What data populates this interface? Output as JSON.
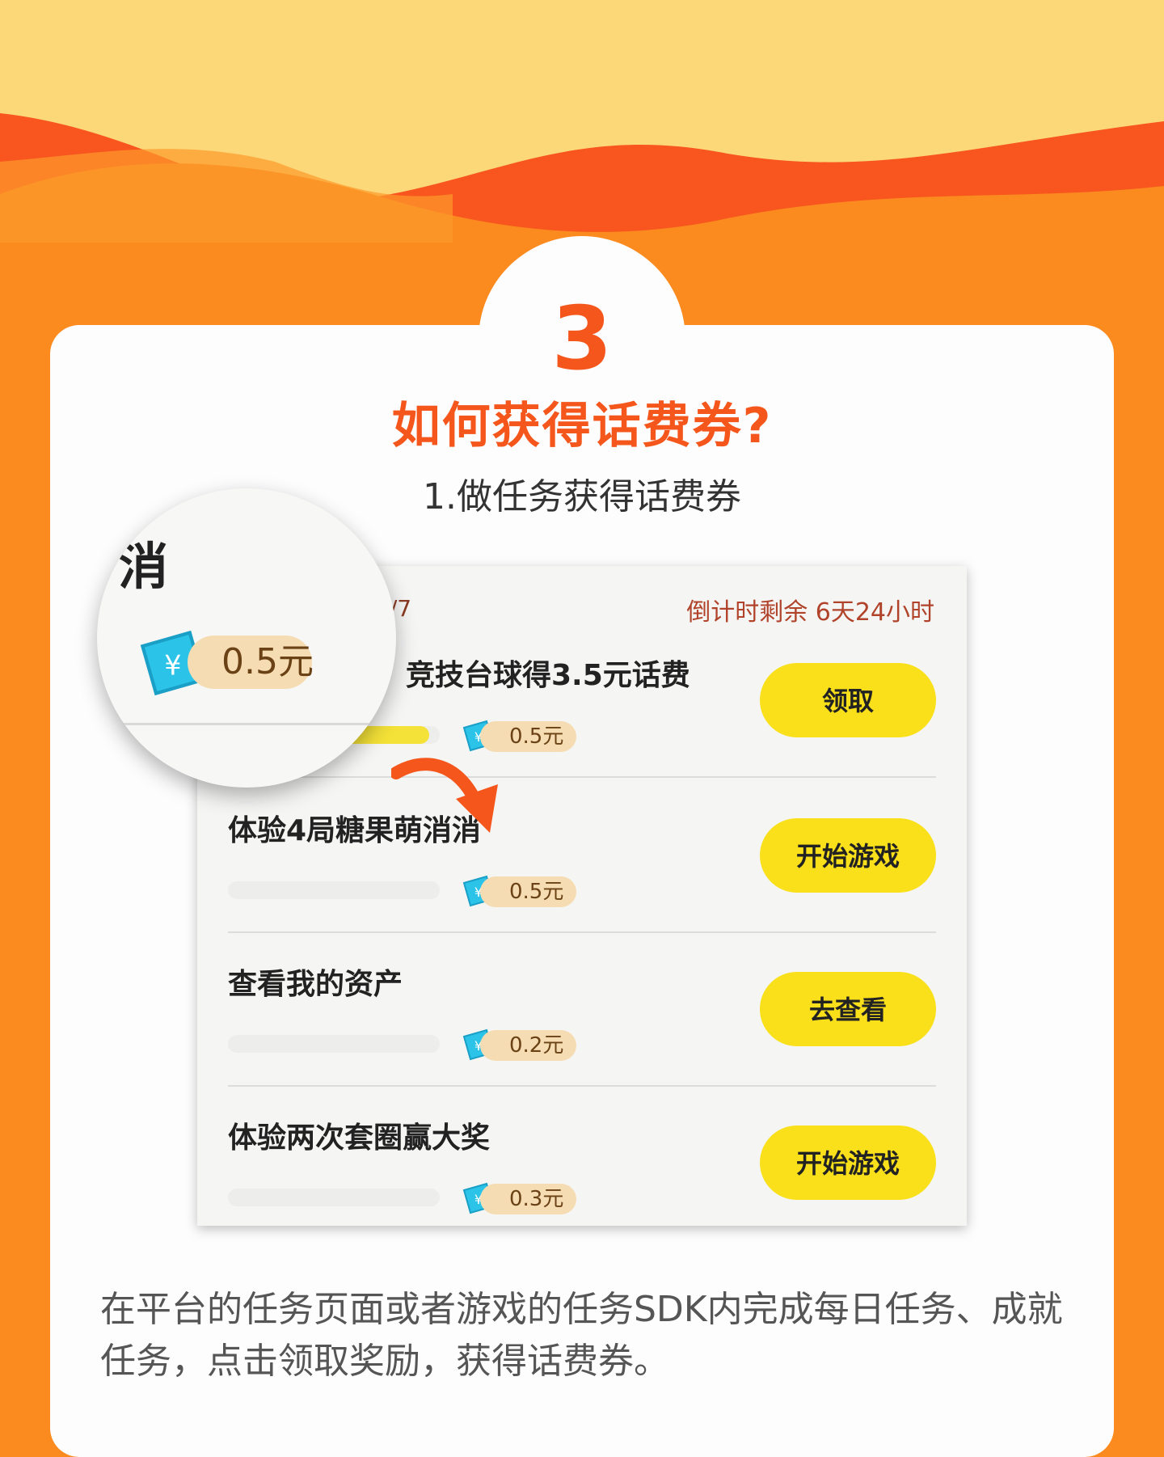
{
  "step_number": "3",
  "title": "如何获得话费券?",
  "subtitle": "1.做任务获得话费券",
  "screenshot": {
    "progress_partial": "0/7",
    "countdown": "倒计时剩余 6天24小时",
    "tasks": [
      {
        "name": "竞技台球得3.5元话费",
        "reward": "0.5元",
        "button": "领取",
        "progress": 0.95
      },
      {
        "name": "体验4局糖果萌消消",
        "reward": "0.5元",
        "button": "开始游戏",
        "progress": 0
      },
      {
        "name": "查看我的资产",
        "reward": "0.2元",
        "button": "去查看",
        "progress": 0
      },
      {
        "name": "体验两次套圈赢大奖",
        "reward": "0.3元",
        "button": "开始游戏",
        "progress": 0
      }
    ]
  },
  "magnifier": {
    "text": "消",
    "reward": "0.5元"
  },
  "description": "在平台的任务页面或者游戏的任务SDK内完成每日任务、成就任务，点击领取奖励，获得话费券。",
  "colors": {
    "background": "#fb8a1f",
    "accent": "#f5561c",
    "button": "#f9e01a",
    "top_band": "#fdd879"
  },
  "icons": [
    "coupon-ticket-icon",
    "curved-arrow-icon"
  ]
}
